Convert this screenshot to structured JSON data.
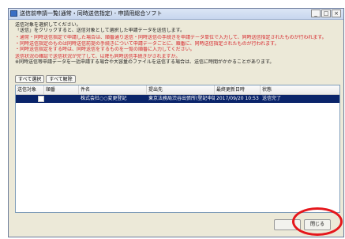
{
  "window": {
    "title": "送信前申請一覧(通常・同時送信指定) - 申請用総合ソフト",
    "controls": [
      "_",
      "□",
      "×"
    ]
  },
  "instructions": [
    {
      "text": "送信対象を選択してください。",
      "red": false
    },
    {
      "text": "「送信」をクリックすると、送信対象として選択した申請データを送信します。",
      "red": false
    },
    {
      "gap": true
    },
    {
      "text": "・通常・同時送信指定で申請した場合は、順番通り送信・同時送信の手続きを申請データ単位で入力して、同時送信指定されたものが行われます。",
      "red": true
    },
    {
      "text": "・同時送信指定のものは同時送信前提の手続きについて申請データごとに、順番に、同時送信指定されたものが行われます。",
      "red": true
    },
    {
      "text": "・同時送信指定をする時は、同時送信をするものを一覧の順番に入力してください。",
      "red": true
    },
    {
      "gap": true
    },
    {
      "text": "送信状況の確認で送信状況が完了して、以降も同時送信手続きがされますか。",
      "red": true
    },
    {
      "text": "※同時送信等申請データを一括申請する場合や大容量のファイルを送信する場合は、送信に時間がかかることがあります。",
      "red": false
    }
  ],
  "select_buttons": {
    "select_all": "すべて選択",
    "deselect_all": "すべて解除"
  },
  "table": {
    "headers": [
      "送信対象",
      "順番",
      "件名",
      "提出先",
      "最終更新日時",
      "状態"
    ],
    "rows": [
      {
        "checked": false,
        "order": "",
        "subject": "株式会社○○変更登記",
        "destination": "東京法務局渋谷出張所(登記申請用)(令...",
        "updated": "2017/09/20 10:53",
        "status": "送信完了"
      }
    ]
  },
  "footer": {
    "ok_label": "",
    "close_label": "閉じる"
  },
  "colors": {
    "selection": "#0a246a",
    "warning_text": "#d6252a",
    "highlight_circle": "#e5171c"
  }
}
